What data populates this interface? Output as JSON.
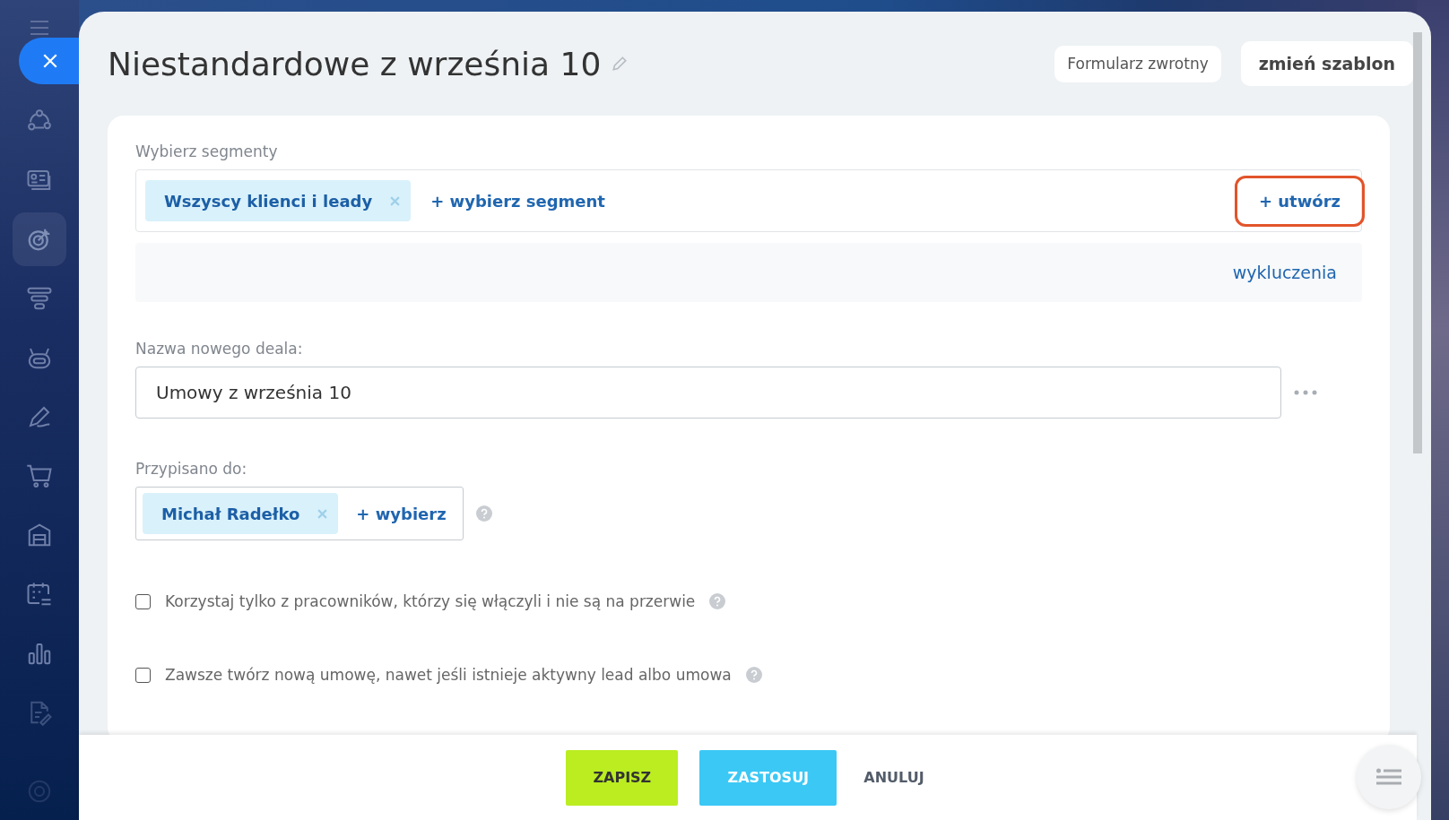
{
  "title": "Niestandardowe z września 10",
  "header_buttons": [
    {
      "label": "Formularz zwrotny",
      "kind": "plain"
    },
    {
      "label": "zmień szablon",
      "kind": "bold"
    }
  ],
  "segments": {
    "label": "Wybierz segmenty",
    "tags": [
      "Wszyscy klienci i leady"
    ],
    "add_link": "+ wybierz segment",
    "create_link": "+ utwórz",
    "create_highlighted": true,
    "exclusions_link": "wykluczenia"
  },
  "deal_name": {
    "label": "Nazwa nowego deala:",
    "value": "Umowy z września 10"
  },
  "assigned": {
    "label": "Przypisano do:",
    "tags": [
      "Michał Radełko"
    ],
    "add_link": "+ wybierz"
  },
  "options": [
    {
      "label": "Korzystaj tylko z pracowników, którzy się włączyli i nie są na przerwie",
      "checked": false
    },
    {
      "label": "Zawsze twórz nową umowę, nawet jeśli istnieje aktywny lead albo umowa",
      "checked": false
    }
  ],
  "footer_buttons": [
    {
      "label": "ZAPISZ",
      "kind": "save"
    },
    {
      "label": "ZASTOSUJ",
      "kind": "apply"
    },
    {
      "label": "ANULUJ",
      "kind": "cancel"
    }
  ]
}
